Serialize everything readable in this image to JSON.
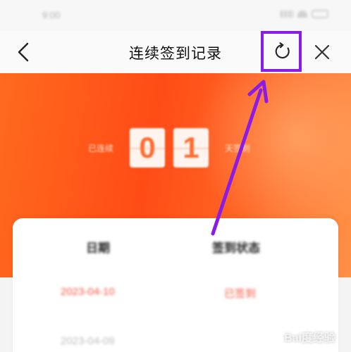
{
  "status_bar": {
    "time": "9:00"
  },
  "nav": {
    "title": "连续签到记录",
    "back_icon": "chevron-left-icon",
    "refresh_icon": "refresh-icon",
    "close_icon": "close-icon"
  },
  "banner": {
    "prefix_label": "已连续",
    "digits": [
      "0",
      "1"
    ],
    "suffix_label": "天签到"
  },
  "record_card": {
    "headers": [
      "日期",
      "签到状态"
    ],
    "rows": [
      {
        "date": "2023-04-10",
        "status": "已签到"
      },
      {
        "date": "2023-04-09",
        "status": ""
      }
    ]
  },
  "watermark": {
    "text": "Bai度经验"
  },
  "colors": {
    "accent_orange": "#ff5a1f",
    "annotation_purple": "#8a1ce6",
    "status_red": "#f0563e"
  }
}
